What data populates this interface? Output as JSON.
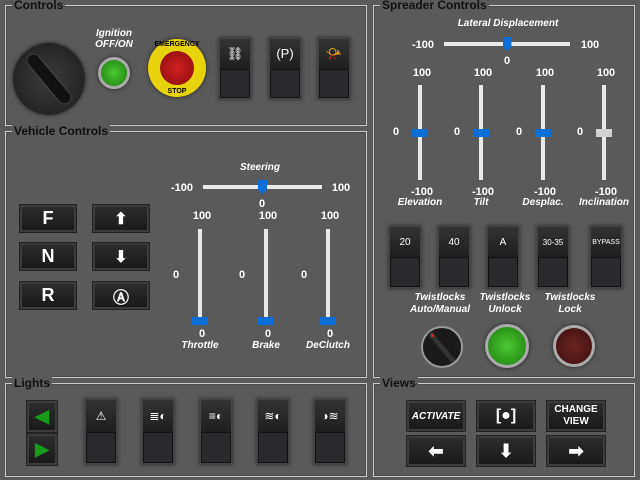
{
  "controls": {
    "title": "Controls",
    "ignition_label": "Ignition OFF/ON",
    "estop_top": "EMERGENCY",
    "estop_bottom": "STOP",
    "switches": [
      {
        "icon": "seatbelt-icon",
        "glyph": "⛓"
      },
      {
        "icon": "parking-brake-icon",
        "glyph": "(P)"
      },
      {
        "icon": "horn-icon",
        "glyph": "📯"
      }
    ]
  },
  "vehicle": {
    "title": "Vehicle Controls",
    "gears": [
      "F",
      "N",
      "R"
    ],
    "arrow_buttons": [
      {
        "icon": "arrow-up-icon",
        "glyph": "⬆"
      },
      {
        "icon": "arrow-down-icon",
        "glyph": "⬇"
      },
      {
        "icon": "auto-gear-icon",
        "glyph": "Ⓐ"
      }
    ],
    "steering": {
      "label": "Steering",
      "min": "-100",
      "max": "100",
      "value": 0
    },
    "sliders": [
      {
        "label": "Throttle",
        "max": "100",
        "mid": "0",
        "min": "0",
        "value": 0
      },
      {
        "label": "Brake",
        "max": "100",
        "mid": "0",
        "min": "0",
        "value": 0
      },
      {
        "label": "DeClutch",
        "max": "100",
        "mid": "0",
        "min": "0",
        "value": 0
      }
    ]
  },
  "spreader": {
    "title": "Spreader Controls",
    "lateral": {
      "label": "Lateral Displacement",
      "min": "-100",
      "max": "100",
      "value": 0
    },
    "sliders": [
      {
        "label": "Elevation",
        "max": "100",
        "mid": "0",
        "min": "-100",
        "value": 0,
        "enabled": true
      },
      {
        "label": "Tilt",
        "max": "100",
        "mid": "0",
        "min": "-100",
        "value": 0,
        "enabled": true
      },
      {
        "label": "Desplac.",
        "max": "100",
        "mid": "0",
        "min": "-100",
        "value": 0,
        "enabled": true
      },
      {
        "label": "Inclination",
        "max": "100",
        "mid": "0",
        "min": "-100",
        "value": 0,
        "enabled": false
      }
    ],
    "switches": [
      "20",
      "40",
      "A",
      "30-35",
      "BYPASS"
    ],
    "twistlocks": [
      "Twistlocks Auto/Manual",
      "Twistlocks Unlock",
      "Twistlocks Lock"
    ]
  },
  "lights": {
    "title": "Lights",
    "switches": [
      {
        "icon": "hazard-icon",
        "glyph": "⚠"
      },
      {
        "icon": "low-beam-icon",
        "glyph": "≣◐"
      },
      {
        "icon": "high-beam-icon",
        "glyph": "≡◐"
      },
      {
        "icon": "fog-light-icon",
        "glyph": "≋◐"
      },
      {
        "icon": "rear-fog-light-icon",
        "glyph": "◑≋"
      }
    ]
  },
  "views": {
    "title": "Views",
    "activate": "ACTIVATE",
    "change_view": "CHANGE VIEW"
  },
  "colors": {
    "accent": "#0a6fd6",
    "led_green": "#2fa11c",
    "led_red": "#5a1818",
    "panel": "#5a5a5a"
  }
}
